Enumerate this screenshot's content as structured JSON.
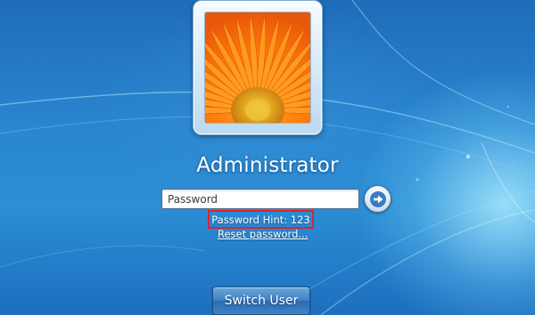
{
  "login": {
    "user_name": "Administrator",
    "password": {
      "placeholder": "Password",
      "value": ""
    },
    "password_hint": "Password Hint: 123",
    "reset_password_label": "Reset password...",
    "submit_icon": "arrow-right-icon",
    "avatar_picture": "orange-gerbera-daisy"
  },
  "footer": {
    "switch_user_label": "Switch User"
  },
  "colors": {
    "background_top": "#1f6cb9",
    "background_glow": "#aaebff",
    "hint_highlight": "#e0222f",
    "button_blue": "#3f82c3"
  }
}
